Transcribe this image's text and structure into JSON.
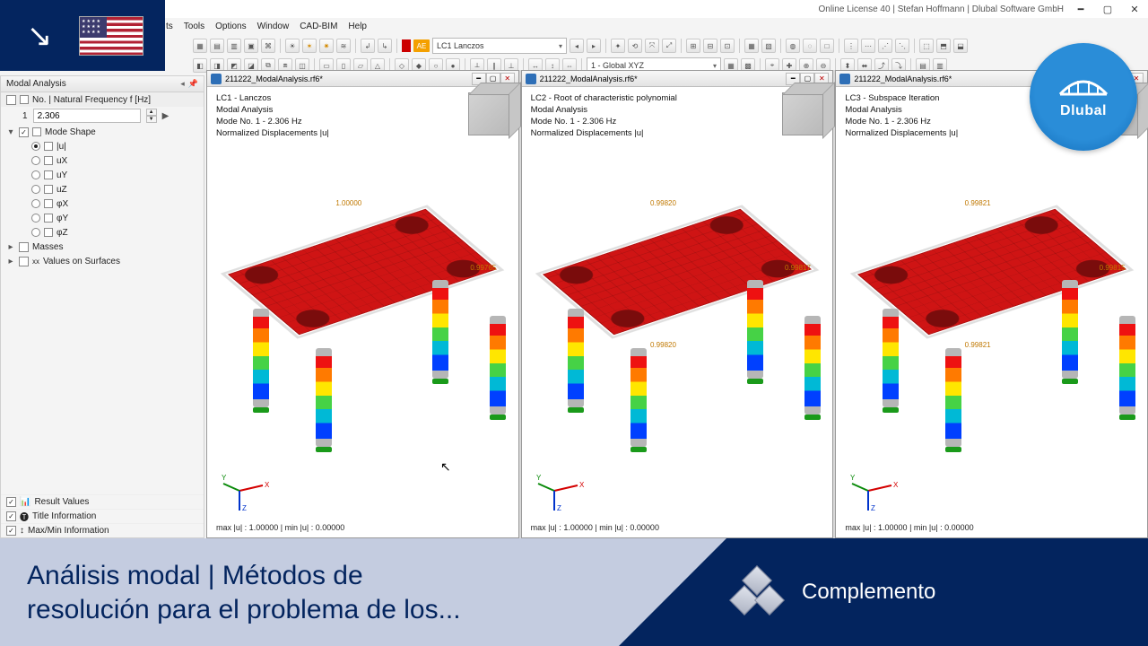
{
  "window": {
    "license_text": "Online License 40 | Stefan Hoffmann | Dlubal Software GmbH"
  },
  "menu": [
    "ts",
    "Tools",
    "Options",
    "Window",
    "CAD-BIM",
    "Help"
  ],
  "toolbar": {
    "lc_badge": "AE",
    "lc_dropdown": "LC1   Lanczos",
    "coord_dropdown": "1 - Global XYZ"
  },
  "sidepanel": {
    "title": "Modal Analysis",
    "col_header": "No. | Natural Frequency f [Hz]",
    "freq_no": "1",
    "freq_value": "2.306",
    "mode_shape_label": "Mode Shape",
    "components": [
      {
        "key": "u",
        "label": "|u|",
        "selected": true
      },
      {
        "key": "ux",
        "label": "uX",
        "selected": false
      },
      {
        "key": "uy",
        "label": "uY",
        "selected": false
      },
      {
        "key": "uz",
        "label": "uZ",
        "selected": false
      },
      {
        "key": "px",
        "label": "φX",
        "selected": false
      },
      {
        "key": "py",
        "label": "φY",
        "selected": false
      },
      {
        "key": "pz",
        "label": "φZ",
        "selected": false
      }
    ],
    "masses_label": "Masses",
    "values_on_surfaces_label": "Values on Surfaces",
    "bottom": [
      "Result Values",
      "Title Information",
      "Max/Min Information"
    ]
  },
  "views": [
    {
      "file": "211222_ModalAnalysis.rf6*",
      "lc_line": "LC1 - Lanczos",
      "analysis_line": "Modal Analysis",
      "mode_line": "Mode No. 1 - 2.306 Hz",
      "disp_line": "Normalized Displacements |u|",
      "val_top": "1.00000",
      "val_right": "0.99765",
      "minmax": "max |u| : 1.00000 | min |u| : 0.00000"
    },
    {
      "file": "211222_ModalAnalysis.rf6*",
      "lc_line": "LC2 - Root of characteristic polynomial",
      "analysis_line": "Modal Analysis",
      "mode_line": "Mode No. 1 - 2.306 Hz",
      "disp_line": "Normalized Displacements |u|",
      "val_top": "0.99820",
      "val_right": "0.99817",
      "val_bottom": "0.99820",
      "minmax": "max |u| : 1.00000 | min |u| : 0.00000"
    },
    {
      "file": "211222_ModalAnalysis.rf6*",
      "lc_line": "LC3 - Subspace Iteration",
      "analysis_line": "Modal Analysis",
      "mode_line": "Mode No. 1 - 2.306 Hz",
      "disp_line": "Normalized Displacements |u|",
      "val_top": "0.99821",
      "val_right": "0.99815",
      "val_bottom": "0.99821",
      "minmax": "max |u| : 1.00000 | min |u| : 0.00000"
    }
  ],
  "axis": {
    "x": "X",
    "y": "Y",
    "z": "Z"
  },
  "banner": {
    "line1": "Análisis modal | Métodos de",
    "line2": "resolución para el problema de los...",
    "tag": "Complemento"
  },
  "brand": {
    "name": "Dlubal"
  }
}
